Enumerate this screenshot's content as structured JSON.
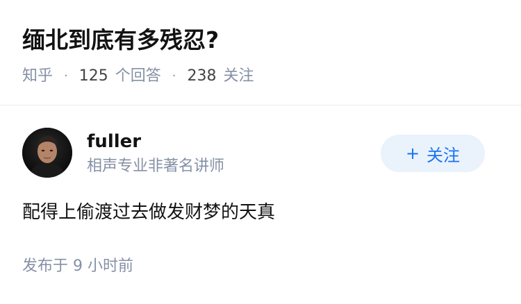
{
  "question": {
    "title": "缅北到底有多残忍?",
    "source": "知乎",
    "answer_count": "125",
    "answer_count_label": "个回答",
    "follower_count": "238",
    "follower_count_label": "关注"
  },
  "answer": {
    "author": {
      "name": "fuller",
      "bio": "相声专业非著名讲师",
      "avatar_icon": "person-portrait-icon"
    },
    "follow_button": {
      "icon": "+",
      "label": "关注"
    },
    "content": "配得上偷渡过去做发财梦的天真",
    "published": "发布于 9 小时前"
  },
  "colors": {
    "accent": "#1772f6",
    "follow_bg": "#eaf2fb",
    "meta_text": "#8590a6",
    "title_text": "#121212",
    "divider": "#ebebeb"
  }
}
